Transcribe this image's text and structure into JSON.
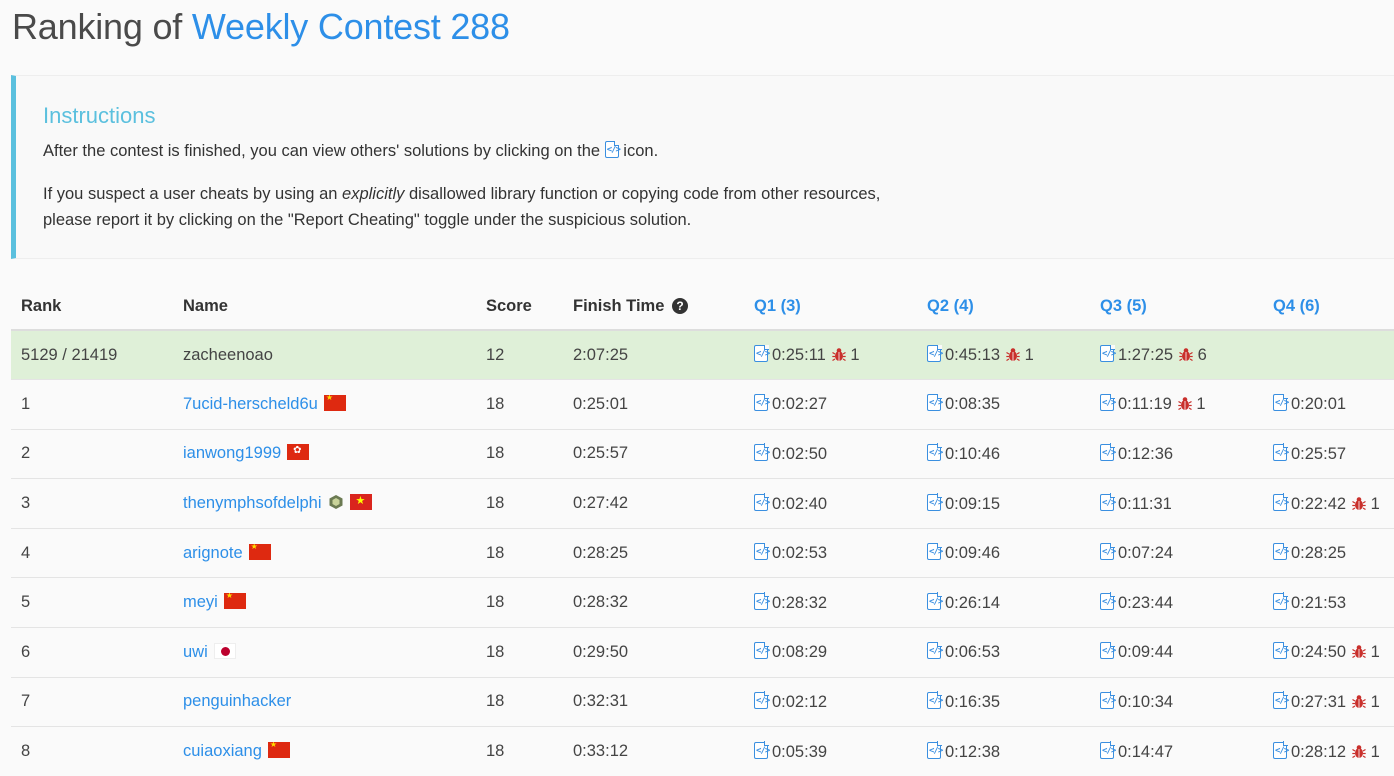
{
  "title": {
    "prefix": "Ranking of",
    "contest": "Weekly Contest 288"
  },
  "instructions": {
    "heading": "Instructions",
    "line1_before": "After the contest is finished, you can view others' solutions by clicking on the",
    "line1_after": "icon.",
    "line2_before": "If you suspect a user cheats by using an",
    "line2_em": "explicitly",
    "line2_after": "disallowed library function or copying code from other resources,",
    "line3": "please report it by clicking on the \"Report Cheating\" toggle under the suspicious solution."
  },
  "table": {
    "headers": {
      "rank": "Rank",
      "name": "Name",
      "score": "Score",
      "finish": "Finish Time",
      "q1": "Q1 (3)",
      "q2": "Q2 (4)",
      "q3": "Q3 (5)",
      "q4": "Q4 (6)"
    },
    "current_user": {
      "rank": "5129 / 21419",
      "name": "zacheenoao",
      "score": "12",
      "finish": "2:07:25",
      "q": [
        {
          "time": "0:25:11",
          "wrong": "1"
        },
        {
          "time": "0:45:13",
          "wrong": "1"
        },
        {
          "time": "1:27:25",
          "wrong": "6"
        },
        null
      ]
    },
    "rows": [
      {
        "rank": "1",
        "name": "7ucid-herscheld6u",
        "flag": "cn",
        "badge": false,
        "score": "18",
        "finish": "0:25:01",
        "q": [
          {
            "time": "0:02:27"
          },
          {
            "time": "0:08:35"
          },
          {
            "time": "0:11:19",
            "wrong": "1"
          },
          {
            "time": "0:20:01"
          }
        ]
      },
      {
        "rank": "2",
        "name": "ianwong1999",
        "flag": "hk",
        "badge": false,
        "score": "18",
        "finish": "0:25:57",
        "q": [
          {
            "time": "0:02:50"
          },
          {
            "time": "0:10:46"
          },
          {
            "time": "0:12:36"
          },
          {
            "time": "0:25:57"
          }
        ]
      },
      {
        "rank": "3",
        "name": "thenymphsofdelphi",
        "flag": "vn",
        "badge": true,
        "score": "18",
        "finish": "0:27:42",
        "q": [
          {
            "time": "0:02:40"
          },
          {
            "time": "0:09:15"
          },
          {
            "time": "0:11:31"
          },
          {
            "time": "0:22:42",
            "wrong": "1"
          }
        ]
      },
      {
        "rank": "4",
        "name": "arignote",
        "flag": "cn",
        "badge": false,
        "score": "18",
        "finish": "0:28:25",
        "q": [
          {
            "time": "0:02:53"
          },
          {
            "time": "0:09:46"
          },
          {
            "time": "0:07:24"
          },
          {
            "time": "0:28:25"
          }
        ]
      },
      {
        "rank": "5",
        "name": "meyi",
        "flag": "cn",
        "badge": false,
        "score": "18",
        "finish": "0:28:32",
        "q": [
          {
            "time": "0:28:32"
          },
          {
            "time": "0:26:14"
          },
          {
            "time": "0:23:44"
          },
          {
            "time": "0:21:53"
          }
        ]
      },
      {
        "rank": "6",
        "name": "uwi",
        "flag": "jp",
        "badge": false,
        "score": "18",
        "finish": "0:29:50",
        "q": [
          {
            "time": "0:08:29"
          },
          {
            "time": "0:06:53"
          },
          {
            "time": "0:09:44"
          },
          {
            "time": "0:24:50",
            "wrong": "1"
          }
        ]
      },
      {
        "rank": "7",
        "name": "penguinhacker",
        "flag": null,
        "badge": false,
        "score": "18",
        "finish": "0:32:31",
        "q": [
          {
            "time": "0:02:12"
          },
          {
            "time": "0:16:35"
          },
          {
            "time": "0:10:34"
          },
          {
            "time": "0:27:31",
            "wrong": "1"
          }
        ]
      },
      {
        "rank": "8",
        "name": "cuiaoxiang",
        "flag": "cn",
        "badge": false,
        "score": "18",
        "finish": "0:33:12",
        "q": [
          {
            "time": "0:05:39"
          },
          {
            "time": "0:12:38"
          },
          {
            "time": "0:14:47"
          },
          {
            "time": "0:28:12",
            "wrong": "1"
          }
        ]
      }
    ]
  },
  "icons": {
    "solution": "code-file-icon",
    "wrong_attempt": "bug-icon",
    "finish_time_help": "question-circle-icon",
    "user_badge": "guardian-badge-icon"
  },
  "colors": {
    "link": "#2d8fe8",
    "callout_accent": "#5bc0de",
    "highlight_row": "#dff0d8",
    "bug": "#c9302c"
  }
}
